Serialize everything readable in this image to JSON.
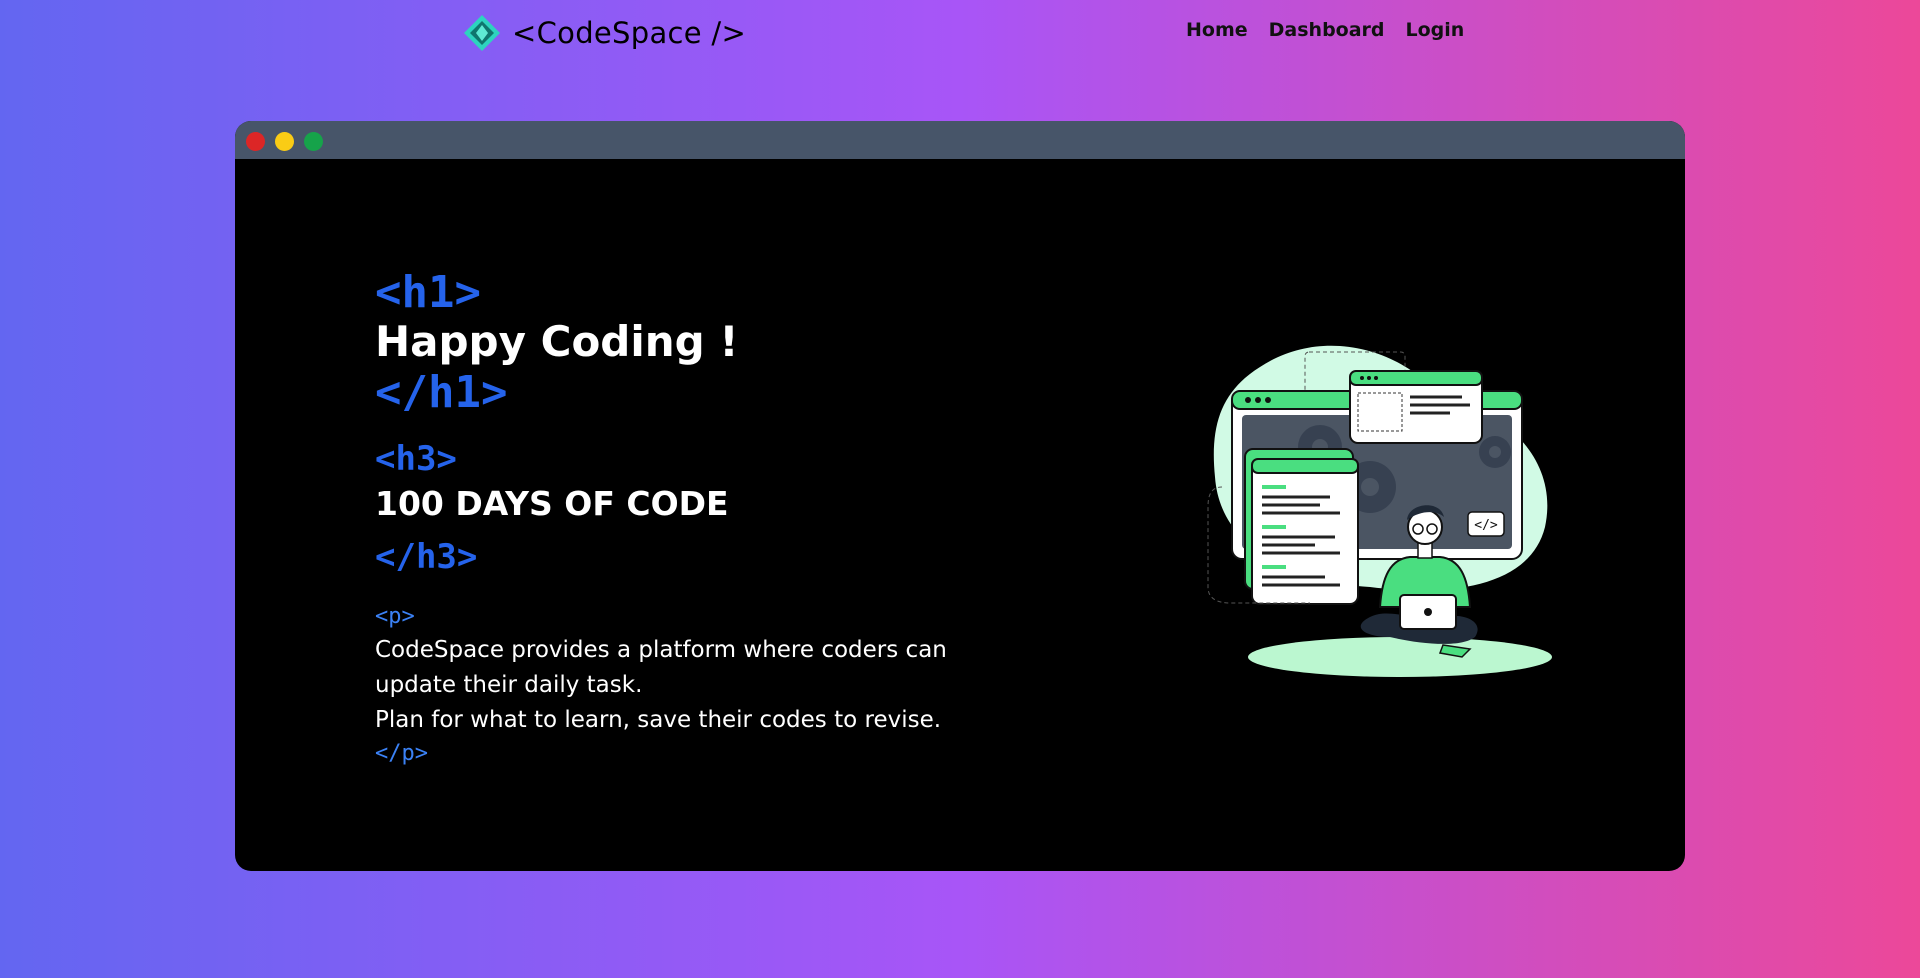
{
  "brand": {
    "name": "<CodeSpace />"
  },
  "nav": {
    "items": [
      "Home",
      "Dashboard",
      "Login"
    ]
  },
  "hero": {
    "h1_open": "<h1>",
    "heading": "Happy Coding !",
    "h1_close": "</h1>",
    "h3_open": "<h3>",
    "subheading": "100 DAYS OF CODE",
    "h3_close": "</h3>",
    "p_open": "<p>",
    "paragraph_line1": "CodeSpace provides a platform where coders can update their daily task.",
    "paragraph_line2": "Plan for what to learn, save their codes to revise.",
    "p_close": "</p>"
  },
  "illustration": {
    "code_badge": "</>"
  },
  "colors": {
    "gradient_start": "#6366f1",
    "gradient_mid": "#a855f7",
    "gradient_end": "#ec4899",
    "tag_blue": "#2563eb",
    "accent_green": "#4ade80",
    "titlebar": "#475569"
  }
}
